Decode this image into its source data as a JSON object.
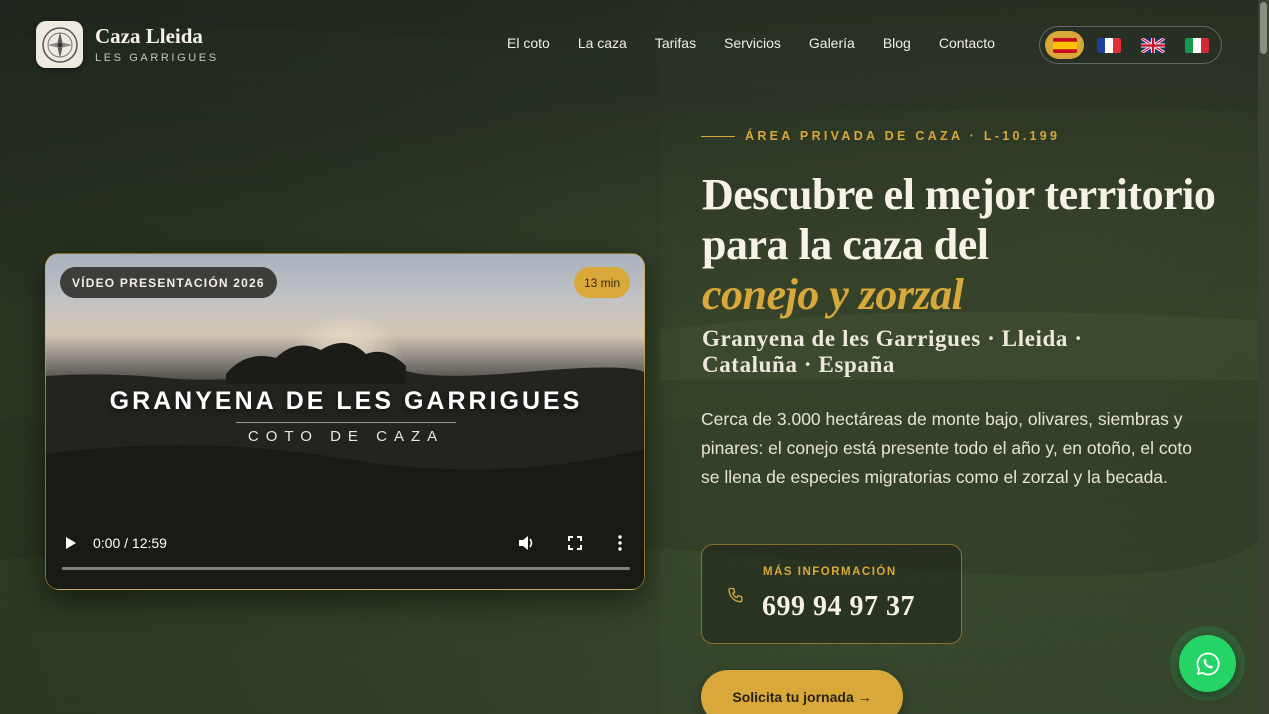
{
  "brand": {
    "title": "Caza Lleida",
    "subtitle": "LES GARRIGUES"
  },
  "nav": {
    "items": [
      "El coto",
      "La caza",
      "Tarifas",
      "Servicios",
      "Galería",
      "Blog",
      "Contacto"
    ]
  },
  "languages": [
    {
      "code": "es",
      "icon": "spain-flag-icon",
      "active": true
    },
    {
      "code": "fr",
      "icon": "france-flag-icon",
      "active": false
    },
    {
      "code": "en",
      "icon": "uk-flag-icon",
      "active": false
    },
    {
      "code": "it",
      "icon": "italy-flag-icon",
      "active": false
    }
  ],
  "video": {
    "badge": "VÍDEO PRESENTACIÓN 2026",
    "duration_badge": "13 min",
    "title": "GRANYENA DE LES GARRIGUES",
    "subtitle": "COTO DE CAZA",
    "time": "0:00 / 12:59",
    "progress": 0
  },
  "hero": {
    "eyebrow": "ÁREA PRIVADA DE CAZA · L-10.199",
    "headline": "Descubre el mejor territorio para la caza del",
    "headline_accent": "conejo y zorzal",
    "location": "Granyena de les Garrigues · Lleida · Cataluña · España",
    "description": "Cerca de 3.000 hectáreas de monte bajo, olivares, siembras y pinares: el conejo está presente todo el año y, en otoño, el coto se llena de especies migratorias como el zorzal y la becada."
  },
  "contact": {
    "label": "MÁS INFORMACIÓN",
    "phone": "699 94 97 37"
  },
  "cta": {
    "label": "Solicita tu jornada →"
  },
  "colors": {
    "accent": "#d8a93a",
    "whatsapp": "#25d366"
  }
}
